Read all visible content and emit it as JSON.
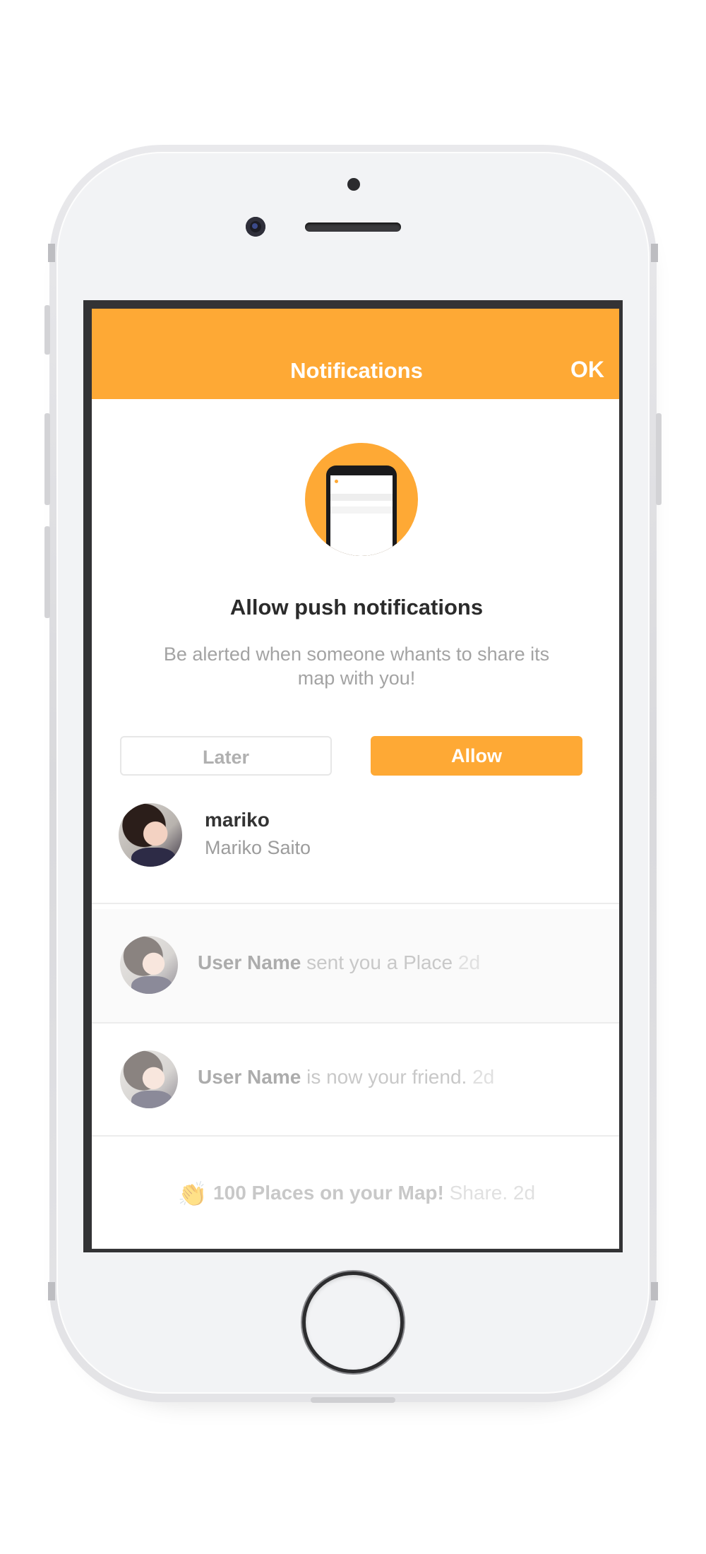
{
  "header": {
    "title": "Notifications",
    "ok_label": "OK"
  },
  "push_prompt": {
    "title": "Allow push notifications",
    "body": "Be alerted when someone whants to share its map with you!",
    "later_label": "Later",
    "allow_label": "Allow",
    "illustration_icon": "phone-illustration-icon"
  },
  "profile": {
    "username": "mariko",
    "full_name": "Mariko Saito"
  },
  "notifications": [
    {
      "user": "User Name",
      "text": " sent you a Place ",
      "time": "2d"
    },
    {
      "user": "User Name",
      "text": " is now your friend. ",
      "time": "2d"
    },
    {
      "icon": "clapping-hands-icon",
      "glyph": "👏",
      "title": "100 Places on your Map!",
      "text": " Share. ",
      "time": "2d"
    }
  ],
  "colors": {
    "accent": "#fea935",
    "text_primary": "#333333",
    "text_secondary": "#9c9c9c"
  }
}
